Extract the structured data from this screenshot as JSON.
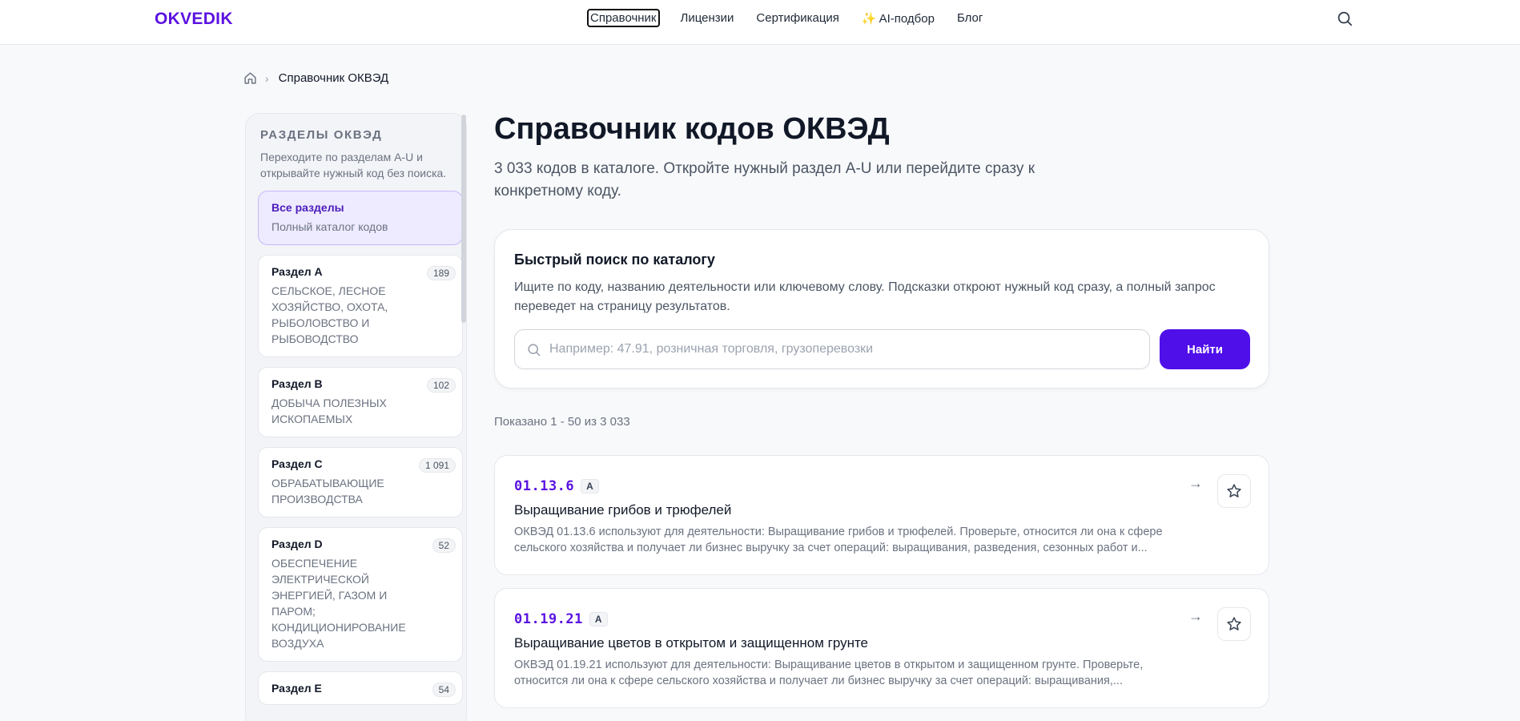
{
  "header": {
    "logo": "OKVEDIK",
    "nav": [
      {
        "label": "Справочник"
      },
      {
        "label": "Лицензии"
      },
      {
        "label": "Сертификация"
      },
      {
        "label": "AI-подбор"
      },
      {
        "label": "Блог"
      }
    ]
  },
  "breadcrumb": {
    "current": "Справочник ОКВЭД"
  },
  "sidebar": {
    "title": "РАЗДЕЛЫ ОКВЭД",
    "description": "Переходите по разделам A-U и открывайте нужный код без поиска.",
    "items": [
      {
        "name": "Все разделы",
        "sub": "Полный каталог кодов",
        "count": ""
      },
      {
        "name": "Раздел A",
        "sub": "СЕЛЬСКОЕ, ЛЕСНОЕ ХОЗЯЙСТВО, ОХОТА, РЫБОЛОВСТВО И РЫБОВОДСТВО",
        "count": "189"
      },
      {
        "name": "Раздел B",
        "sub": "ДОБЫЧА ПОЛЕЗНЫХ ИСКОПАЕМЫХ",
        "count": "102"
      },
      {
        "name": "Раздел C",
        "sub": "ОБРАБАТЫВАЮЩИЕ ПРОИЗВОДСТВА",
        "count": "1 091"
      },
      {
        "name": "Раздел D",
        "sub": "ОБЕСПЕЧЕНИЕ ЭЛЕКТРИЧЕСКОЙ ЭНЕРГИЕЙ, ГАЗОМ И ПАРОМ; КОНДИЦИОНИРОВАНИЕ ВОЗДУХА",
        "count": "52"
      },
      {
        "name": "Раздел E",
        "sub": "",
        "count": "54"
      }
    ]
  },
  "main": {
    "title": "Справочник кодов ОКВЭД",
    "subtitle": "3 033 кодов в каталоге. Откройте нужный раздел A-U или перейдите сразу к конкретному коду.",
    "search": {
      "heading": "Быстрый поиск по каталогу",
      "description": "Ищите по коду, названию деятельности или ключевому слову. Подсказки откроют нужный код сразу, а полный запрос переведет на страницу результатов.",
      "placeholder": "Например: 47.91, розничная торговля, грузоперевозки",
      "value": "",
      "button": "Найти"
    },
    "shown": "Показано 1 - 50 из 3 033",
    "results": [
      {
        "code": "01.13.6",
        "section": "A",
        "title": "Выращивание грибов и трюфелей",
        "description": "ОКВЭД 01.13.6 используют для деятельности: Выращивание грибов и трюфелей. Проверьте, относится ли она к сфере сельского хозяйства и получает ли бизнес выручку за счет операций: выращивания, разведения, сезонных работ и..."
      },
      {
        "code": "01.19.21",
        "section": "A",
        "title": "Выращивание цветов в открытом и защищенном грунте",
        "description": "ОКВЭД 01.19.21 используют для деятельности: Выращивание цветов в открытом и защищенном грунте. Проверьте, относится ли она к сфере сельского хозяйства и получает ли бизнес выручку за счет операций: выращивания,..."
      }
    ]
  },
  "colors": {
    "accent": "#4f0fe8",
    "logo": "#5b12e0"
  },
  "icons": [
    "search-icon",
    "home-icon",
    "chevron-right-icon",
    "sparkle-icon",
    "arrow-right-icon",
    "star-icon"
  ]
}
